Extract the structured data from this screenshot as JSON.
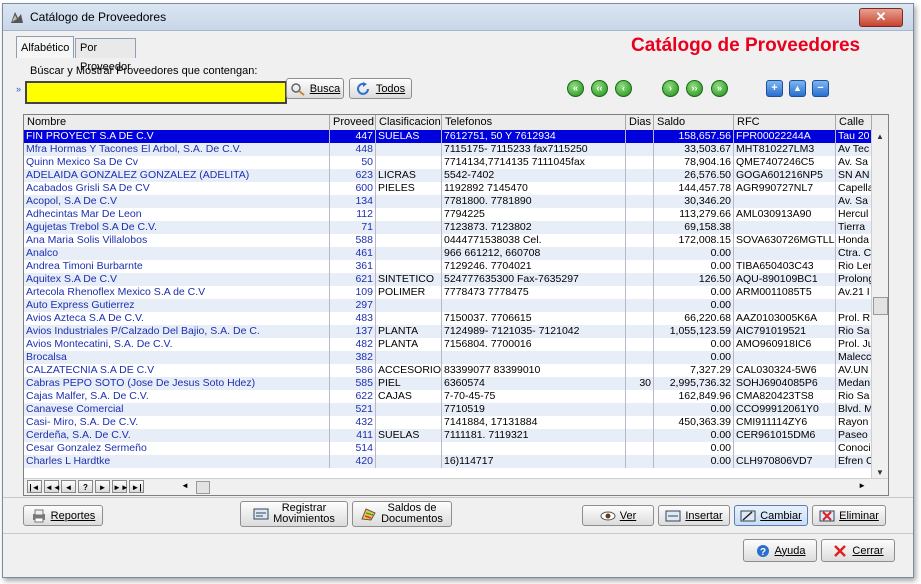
{
  "window": {
    "title": "Catálogo de Proveedores",
    "close_label": "✕"
  },
  "tabs": [
    {
      "label": "Alfabético"
    },
    {
      "label": "Por Proveedor"
    }
  ],
  "page_title": "Catálogo de Proveedores",
  "search": {
    "label": "Búscar y Mostrar Proveedores que contengan:",
    "marker": "»",
    "value": "",
    "placeholder": "",
    "busca_label": "Busca",
    "todos_label": "Todos"
  },
  "grid": {
    "columns": [
      "Nombre",
      "Proveed",
      "Clasificacion",
      "Telefonos",
      "Dias",
      "Saldo",
      "RFC",
      "Calle"
    ],
    "rows": [
      {
        "nombre": "FIN PROYECT S.A DE C.V",
        "proveed": "447",
        "clasif": "SUELAS",
        "tel": "7612751, 50 Y 7612934",
        "dias": "",
        "saldo": "158,657.56",
        "rfc": "FPR00022244A",
        "calle": "Tau 20"
      },
      {
        "nombre": "Mfra Hormas Y Tacones El Arbol, S.A. De C.V.",
        "proveed": "448",
        "clasif": "",
        "tel": "7115175- 7115233 fax7115250",
        "dias": "",
        "saldo": "33,503.67",
        "rfc": "MHT810227LM3",
        "calle": "Av Tec"
      },
      {
        "nombre": "Quinn Mexico Sa De Cv",
        "proveed": "50",
        "clasif": "",
        "tel": "7714134,7714135 7111045fax",
        "dias": "",
        "saldo": "78,904.16",
        "rfc": "QME7407246C5",
        "calle": "Av. Sa"
      },
      {
        "nombre": "ADELAIDA GONZALEZ GONZALEZ (ADELITA)",
        "proveed": "623",
        "clasif": "LICRAS",
        "tel": "5542-7402",
        "dias": "",
        "saldo": "26,576.50",
        "rfc": "GOGA601216NP5",
        "calle": "SN AN"
      },
      {
        "nombre": "Acabados Grisli SA De CV",
        "proveed": "600",
        "clasif": "PIELES",
        "tel": "1192892    7145470",
        "dias": "",
        "saldo": "144,457.78",
        "rfc": "AGR990727NL7",
        "calle": "Capella"
      },
      {
        "nombre": "Acopol, S.A De C.V",
        "proveed": "134",
        "clasif": "",
        "tel": "7781800. 7781890",
        "dias": "",
        "saldo": "30,346.20",
        "rfc": "",
        "calle": "Av. Sa"
      },
      {
        "nombre": "Adhecintas Mar De Leon",
        "proveed": "112",
        "clasif": "",
        "tel": "7794225",
        "dias": "",
        "saldo": "113,279.66",
        "rfc": "AML030913A90",
        "calle": "Hercul"
      },
      {
        "nombre": "Agujetas Trebol S.A De C.V.",
        "proveed": "71",
        "clasif": "",
        "tel": "7123873. 7123802",
        "dias": "",
        "saldo": "69,158.38",
        "rfc": "",
        "calle": "Tierra"
      },
      {
        "nombre": "Ana Maria Solis Villalobos",
        "proveed": "588",
        "clasif": "",
        "tel": "0444771538038  Cel.",
        "dias": "",
        "saldo": "172,008.15",
        "rfc": "SOVA630726MGTLL",
        "calle": "Honda"
      },
      {
        "nombre": "Analco",
        "proveed": "461",
        "clasif": "",
        "tel": "966 661212, 660708",
        "dias": "",
        "saldo": "0.00",
        "rfc": "",
        "calle": "Ctra. C"
      },
      {
        "nombre": "Andrea Timoni Burbarnte",
        "proveed": "361",
        "clasif": "",
        "tel": "7129246. 7704021",
        "dias": "",
        "saldo": "0.00",
        "rfc": "TIBA650403C43",
        "calle": "Rio Ler"
      },
      {
        "nombre": "Aquitex S.A De C.V",
        "proveed": "621",
        "clasif": "SINTETICO",
        "tel": "524777635300  Fax-7635297",
        "dias": "",
        "saldo": "126.50",
        "rfc": "AQU-890109BC1",
        "calle": "Prolong"
      },
      {
        "nombre": "Artecola  Rhenoflex Mexico S.A de C.V",
        "proveed": "109",
        "clasif": "POLIMER",
        "tel": "7778473  7778475",
        "dias": "",
        "saldo": "0.00",
        "rfc": "ARM0011085T5",
        "calle": "Av.21 I"
      },
      {
        "nombre": "Auto Express Gutierrez",
        "proveed": "297",
        "clasif": "",
        "tel": "",
        "dias": "",
        "saldo": "0.00",
        "rfc": "",
        "calle": ""
      },
      {
        "nombre": "Avios Azteca S.A De C.V.",
        "proveed": "483",
        "clasif": "",
        "tel": "7150037.  7706615",
        "dias": "",
        "saldo": "66,220.68",
        "rfc": "AAZ0103005K6A",
        "calle": "Prol. R"
      },
      {
        "nombre": "Avios Industriales P/Calzado Del Bajio, S.A. De C.",
        "proveed": "137",
        "clasif": "PLANTA",
        "tel": "7124989- 7121035- 7121042",
        "dias": "",
        "saldo": "1,055,123.59",
        "rfc": "AIC791019521",
        "calle": "Rio Sa"
      },
      {
        "nombre": "Avios Montecatini, S.A. De C.V.",
        "proveed": "482",
        "clasif": "PLANTA",
        "tel": "7156804.  7700016",
        "dias": "",
        "saldo": "0.00",
        "rfc": "AMO960918IC6",
        "calle": "Prol. Ju"
      },
      {
        "nombre": "Brocalsa",
        "proveed": "382",
        "clasif": "",
        "tel": "",
        "dias": "",
        "saldo": "0.00",
        "rfc": "",
        "calle": "Malecc"
      },
      {
        "nombre": "CALZATECNIA S.A DE C.V",
        "proveed": "586",
        "clasif": "ACCESORIOS",
        "tel": "83399077    83399010",
        "dias": "",
        "saldo": "7,327.29",
        "rfc": "CAL030324-5W6",
        "calle": "AV.UN"
      },
      {
        "nombre": "Cabras PEPO SOTO (Jose De Jesus Soto Hdez)",
        "proveed": "585",
        "clasif": "PIEL",
        "tel": "6360574",
        "dias": "30",
        "saldo": "2,995,736.32",
        "rfc": "SOHJ6904085P6",
        "calle": "Medan"
      },
      {
        "nombre": "Cajas Malfer, S.A. De C.V.",
        "proveed": "622",
        "clasif": "CAJAS",
        "tel": "7-70-45-75",
        "dias": "",
        "saldo": "162,849.96",
        "rfc": "CMA820423TS8",
        "calle": "Rio Sa"
      },
      {
        "nombre": "Canavese Comercial",
        "proveed": "521",
        "clasif": "",
        "tel": "7710519",
        "dias": "",
        "saldo": "0.00",
        "rfc": "CCO99912061Y0",
        "calle": "Blvd. M"
      },
      {
        "nombre": "Casi- Miro, S.A. De C.V.",
        "proveed": "432",
        "clasif": "",
        "tel": "7141884, 17131884",
        "dias": "",
        "saldo": "450,363.39",
        "rfc": "CMI911114ZY6",
        "calle": "Rayon"
      },
      {
        "nombre": "Cerdeña, S.A. De C.V.",
        "proveed": "411",
        "clasif": "SUELAS",
        "tel": "7111181.  7119321",
        "dias": "",
        "saldo": "0.00",
        "rfc": "CER961015DM6",
        "calle": "Paseo"
      },
      {
        "nombre": "Cesar Gonzalez Sermeño",
        "proveed": "514",
        "clasif": "",
        "tel": "",
        "dias": "",
        "saldo": "0.00",
        "rfc": "",
        "calle": "Conoci"
      },
      {
        "nombre": "Charles L Hardtke",
        "proveed": "420",
        "clasif": "",
        "tel": "16)114717",
        "dias": "",
        "saldo": "0.00",
        "rfc": "CLH970806VD7",
        "calle": "Efren C"
      }
    ],
    "nav_buttons": [
      "|◄",
      "◄◄",
      "◄",
      "?",
      "►",
      "►►",
      "►|"
    ]
  },
  "buttons": {
    "reportes": "Reportes",
    "registrar_1": "Registrar",
    "registrar_2": "Movimientos",
    "saldos_1": "Saldos de",
    "saldos_2": "Documentos",
    "ver": "Ver",
    "insertar": "Insertar",
    "cambiar": "Cambiar",
    "eliminar": "Eliminar",
    "ayuda": "Ayuda",
    "cerrar": "Cerrar"
  },
  "colors": {
    "title_red": "#e8001c",
    "search_yellow": "#ffff00",
    "selection_blue": "#0000dd",
    "link_blue": "#1c2fb0"
  }
}
